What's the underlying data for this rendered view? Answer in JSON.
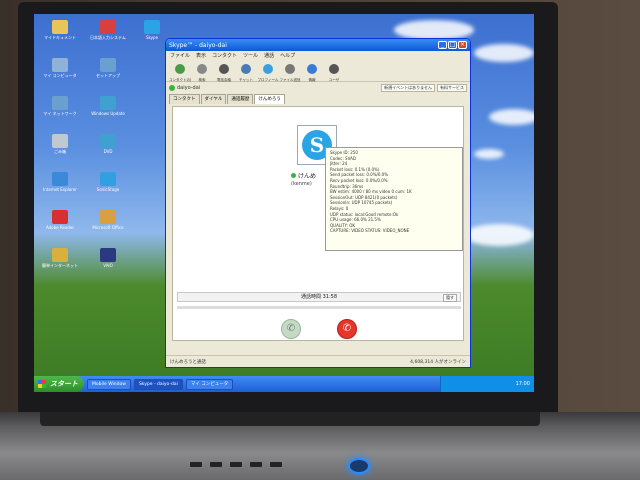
{
  "desktop": {
    "icons": [
      {
        "label": "マイドキュメント",
        "color": "#e8c45a"
      },
      {
        "label": "マイ コンピュータ",
        "color": "#8fb2d8"
      },
      {
        "label": "マイ ネットワーク",
        "color": "#6aa0d0"
      },
      {
        "label": "ごみ箱",
        "color": "#c0c8d0"
      },
      {
        "label": "Internet Explorer",
        "color": "#3a8ad8"
      },
      {
        "label": "Adobe Reader",
        "color": "#d83030"
      },
      {
        "label": "簡単インターネット",
        "color": "#d8b040"
      },
      {
        "label": "日本語入力システム",
        "color": "#d84040"
      },
      {
        "label": "セットアップ",
        "color": "#6aa0d0"
      },
      {
        "label": "Windows Update",
        "color": "#40a0d0"
      },
      {
        "label": "DVD",
        "color": "#40a0d0"
      },
      {
        "label": "SonicStage",
        "color": "#30a0e0"
      },
      {
        "label": "Microsoft Office",
        "color": "#d8a040"
      },
      {
        "label": "VAIO",
        "color": "#2a3a80"
      },
      {
        "label": "Skype",
        "color": "#2ba4e6"
      }
    ]
  },
  "skype_window": {
    "title": "Skype™ - daiyo-dai",
    "menu": [
      "ファイル",
      "表示",
      "コンタクト",
      "ツール",
      "通話",
      "ヘルプ"
    ],
    "toolbar": [
      {
        "label": "コンタクトの追加",
        "color": "#4a9a4a"
      },
      {
        "label": "検索",
        "color": "#888888"
      },
      {
        "label": "電話会議",
        "color": "#555555"
      },
      {
        "label": "チャット",
        "color": "#4a7ab8"
      },
      {
        "label": "プロフィール",
        "color": "#3aa0e0"
      },
      {
        "label": "ファイル送信",
        "color": "#777777"
      },
      {
        "label": "情報",
        "color": "#3a7ad8"
      },
      {
        "label": "ユーザ",
        "color": "#555555"
      }
    ],
    "user": "daiyo-dai",
    "status_pills": [
      "新規イベントはありません",
      "有料サービス"
    ],
    "tabs": [
      "コンタクト",
      "ダイヤル",
      "通話履歴",
      "けんめろう"
    ],
    "active_tab_index": 3,
    "contact_name": "けんめ",
    "contact_sub": "(kenme)",
    "tech_info": [
      "Skype ID: 250",
      "Codec: SVAD",
      "Jitter: 24",
      "Packet loss: 0.1% (0.0%)",
      "Send packet loss: 0.0%/0.0%",
      "Recv packet loss: 0.0%/0.0%",
      "Roundtrip: 36ms",
      "BW estim: 4000 / 80 ms video 0 cum: 1K",
      "SessionOut: UDP 8421(0 packets)",
      "SessionIn: UDP 10745 packets)",
      "Relays: 0",
      "UDP status: local:Good remote:Ok",
      "CPU usage: 66.0% 21.5%",
      "QUALITY: OK",
      "CAPTURE: VIDEO STATUS: VIDEO_NONE"
    ],
    "call_time_label": "通話時間 31:58",
    "hide_label": "隠す",
    "statusbar_left": "けんめろうと通話",
    "statusbar_right": "4,608,314 人がオンライン"
  },
  "taskbar": {
    "start_label": "スタート",
    "tasks": [
      "Mobile Window",
      "Skype - daiyo-dai",
      "マイ コンピュータ"
    ],
    "tray_time": "17:00"
  }
}
